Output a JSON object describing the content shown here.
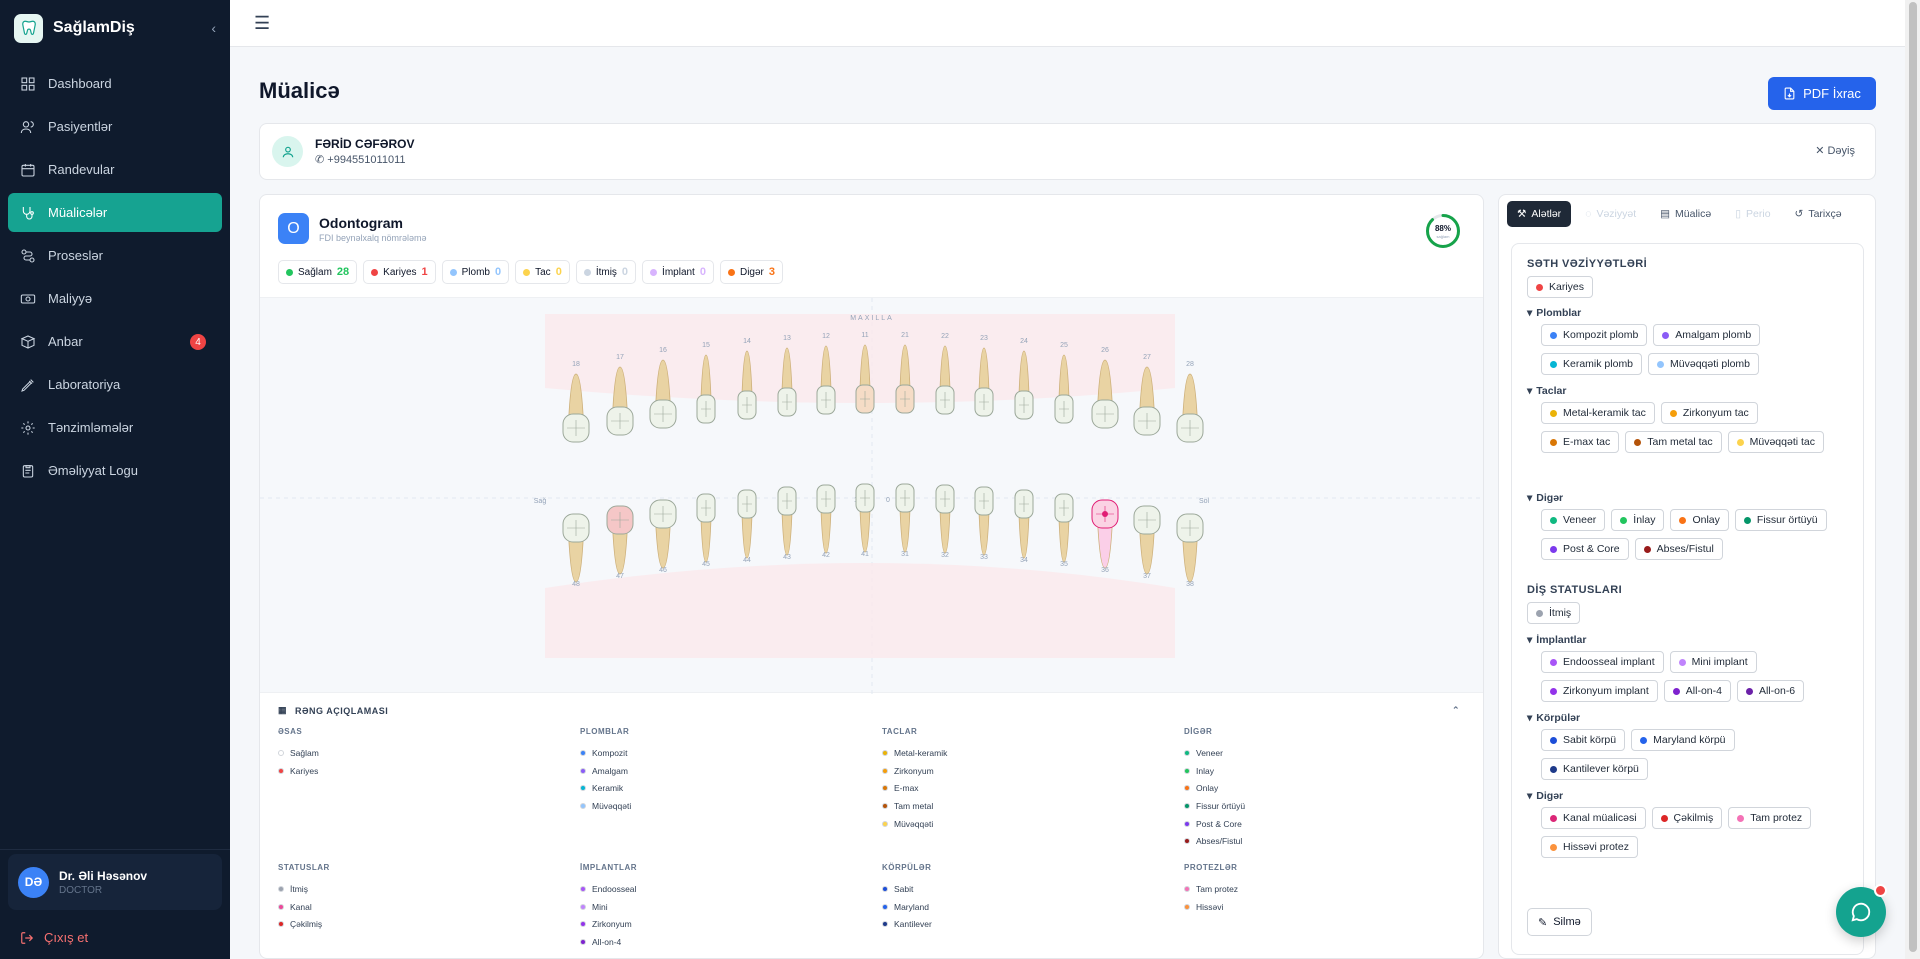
{
  "brand": {
    "name": "SağlamDiş"
  },
  "nav": [
    {
      "label": "Dashboard",
      "icon": "grid-icon",
      "active": false
    },
    {
      "label": "Pasiyentlər",
      "icon": "users-icon",
      "active": false
    },
    {
      "label": "Randevular",
      "icon": "calendar-icon",
      "active": false
    },
    {
      "label": "Müalicələr",
      "icon": "stethoscope-icon",
      "active": true
    },
    {
      "label": "Proseslər",
      "icon": "workflow-icon",
      "active": false
    },
    {
      "label": "Maliyyə",
      "icon": "money-icon",
      "active": false
    },
    {
      "label": "Anbar",
      "icon": "box-icon",
      "active": false,
      "badge": "4"
    },
    {
      "label": "Laboratoriya",
      "icon": "pipette-icon",
      "active": false
    },
    {
      "label": "Tənzimləmələr",
      "icon": "settings-icon",
      "active": false
    },
    {
      "label": "Əməliyyat Logu",
      "icon": "clipboard-icon",
      "active": false
    }
  ],
  "user": {
    "initials": "DƏ",
    "name": "Dr. Əli Həsənov",
    "role": "DOCTOR"
  },
  "logout": "Çıxış et",
  "page": {
    "title": "Müalicə",
    "pdf_button": "PDF İxrac"
  },
  "patient": {
    "name": "FƏRİD CƏFƏROV",
    "phone": "+994551011011",
    "change": "Dəyiş"
  },
  "odontogram": {
    "icon_letter": "O",
    "title": "Odontogram",
    "subtitle": "FDI beynəlxalq nömrələmə",
    "health_percent": "88%",
    "health_label": "sağlam",
    "health_value": 0.88,
    "chips": [
      {
        "label": "Sağlam",
        "count": "28",
        "color": "#22c55e"
      },
      {
        "label": "Kariyes",
        "count": "1",
        "color": "#ef4444"
      },
      {
        "label": "Plomb",
        "count": "0",
        "color": "#93c5fd"
      },
      {
        "label": "Tac",
        "count": "0",
        "color": "#fcd34d"
      },
      {
        "label": "İtmiş",
        "count": "0",
        "color": "#cbd5e1"
      },
      {
        "label": "İmplant",
        "count": "0",
        "color": "#d8b4fe"
      },
      {
        "label": "Digər",
        "count": "3",
        "color": "#f97316"
      }
    ],
    "upper_label": "MAXILLA",
    "side_left": "Sağ",
    "side_right": "Sol",
    "mid_top": "1",
    "mid_right": "0",
    "upper_teeth": [
      "18",
      "17",
      "16",
      "15",
      "14",
      "13",
      "12",
      "11",
      "21",
      "22",
      "23",
      "24",
      "25",
      "26",
      "27",
      "28"
    ],
    "lower_teeth": [
      "48",
      "47",
      "46",
      "45",
      "44",
      "43",
      "42",
      "41",
      "31",
      "32",
      "33",
      "34",
      "35",
      "36",
      "37",
      "38"
    ]
  },
  "legend": {
    "title": "RƏNG AÇIQLAMASI",
    "groups": [
      {
        "title": "ƏSAS",
        "items": [
          {
            "label": "Sağlam",
            "color": "#ffffff"
          },
          {
            "label": "Kariyes",
            "color": "#ef4444"
          }
        ]
      },
      {
        "title": "PLOMBLAR",
        "items": [
          {
            "label": "Kompozit",
            "color": "#3b82f6"
          },
          {
            "label": "Amalgam",
            "color": "#8b5cf6"
          },
          {
            "label": "Keramik",
            "color": "#06b6d4"
          },
          {
            "label": "Müvəqqəti",
            "color": "#93c5fd"
          }
        ]
      },
      {
        "title": "TACLAR",
        "items": [
          {
            "label": "Metal-keramik",
            "color": "#eab308"
          },
          {
            "label": "Zirkonyum",
            "color": "#f59e0b"
          },
          {
            "label": "E-max",
            "color": "#d97706"
          },
          {
            "label": "Tam metal",
            "color": "#b45309"
          },
          {
            "label": "Müvəqqəti",
            "color": "#fcd34d"
          }
        ]
      },
      {
        "title": "DİGƏR",
        "items": [
          {
            "label": "Veneer",
            "color": "#10b981"
          },
          {
            "label": "Inlay",
            "color": "#22c55e"
          },
          {
            "label": "Onlay",
            "color": "#f97316"
          },
          {
            "label": "Fissur örtüyü",
            "color": "#059669"
          },
          {
            "label": "Post & Core",
            "color": "#7c3aed"
          },
          {
            "label": "Abses/Fistul",
            "color": "#991b1b"
          }
        ]
      },
      {
        "title": "STATUSLAR",
        "items": [
          {
            "label": "İtmiş",
            "color": "#9ca3af"
          },
          {
            "label": "Kanal",
            "color": "#ec4899"
          },
          {
            "label": "Çəkilmiş",
            "color": "#dc2626"
          }
        ]
      },
      {
        "title": "İMPLANTLAR",
        "items": [
          {
            "label": "Endoosseal",
            "color": "#a855f7"
          },
          {
            "label": "Mini",
            "color": "#c084fc"
          },
          {
            "label": "Zirkonyum",
            "color": "#9333ea"
          },
          {
            "label": "All-on-4",
            "color": "#7e22ce"
          }
        ]
      },
      {
        "title": "KÖRPÜLƏR",
        "items": [
          {
            "label": "Sabit",
            "color": "#1d4ed8"
          },
          {
            "label": "Maryland",
            "color": "#2563eb"
          },
          {
            "label": "Kantilever",
            "color": "#1e3a8a"
          }
        ]
      },
      {
        "title": "PROTEZLƏR",
        "items": [
          {
            "label": "Tam protez",
            "color": "#f472b6"
          },
          {
            "label": "Hissəvi",
            "color": "#fb923c"
          }
        ]
      }
    ]
  },
  "panel": {
    "tabs": [
      {
        "label": "Alətlər",
        "icon": "wrench-icon",
        "state": "active"
      },
      {
        "label": "Vəziyyət",
        "icon": "status-icon",
        "state": "disabled"
      },
      {
        "label": "Müalicə",
        "icon": "clipboard-icon",
        "state": "normal"
      },
      {
        "label": "Perio",
        "icon": "doc-icon",
        "state": "disabled"
      },
      {
        "label": "Tarixçə",
        "icon": "history-icon",
        "state": "normal"
      }
    ],
    "surface_title": "SƏTH VƏZİYYƏTLƏRİ",
    "caries": {
      "label": "Kariyes",
      "color": "#ef4444"
    },
    "fillings_title": "Plomblar",
    "fillings": [
      {
        "label": "Kompozit plomb",
        "color": "#3b82f6"
      },
      {
        "label": "Amalgam plomb",
        "color": "#8b5cf6"
      },
      {
        "label": "Keramik plomb",
        "color": "#06b6d4"
      },
      {
        "label": "Müvəqqəti plomb",
        "color": "#93c5fd"
      }
    ],
    "crowns_title": "Taclar",
    "crowns": [
      {
        "label": "Metal-keramik tac",
        "color": "#eab308"
      },
      {
        "label": "Zirkonyum tac",
        "color": "#f59e0b"
      },
      {
        "label": "E-max tac",
        "color": "#d97706"
      },
      {
        "label": "Tam metal tac",
        "color": "#b45309"
      },
      {
        "label": "Müvəqqəti tac",
        "color": "#fcd34d"
      }
    ],
    "other_title": "Digər",
    "other": [
      {
        "label": "Veneer",
        "color": "#10b981"
      },
      {
        "label": "İnlay",
        "color": "#22c55e"
      },
      {
        "label": "Onlay",
        "color": "#f97316"
      },
      {
        "label": "Fissur örtüyü",
        "color": "#059669"
      },
      {
        "label": "Post & Core",
        "color": "#7c3aed"
      },
      {
        "label": "Abses/Fistul",
        "color": "#991b1b"
      }
    ],
    "status_title": "DİŞ STATUSLARI",
    "missing": {
      "label": "İtmiş",
      "color": "#9ca3af"
    },
    "implants_title": "İmplantlar",
    "implants": [
      {
        "label": "Endoosseal implant",
        "color": "#a855f7"
      },
      {
        "label": "Mini implant",
        "color": "#c084fc"
      },
      {
        "label": "Zirkonyum implant",
        "color": "#9333ea"
      },
      {
        "label": "All-on-4",
        "color": "#7e22ce"
      },
      {
        "label": "All-on-6",
        "color": "#6b21a8"
      }
    ],
    "bridges_title": "Körpülər",
    "bridges": [
      {
        "label": "Sabit körpü",
        "color": "#1d4ed8"
      },
      {
        "label": "Maryland körpü",
        "color": "#2563eb"
      },
      {
        "label": "Kantilever körpü",
        "color": "#1e3a8a"
      }
    ],
    "other2_title": "Digər",
    "other2": [
      {
        "label": "Kanal müalicəsi",
        "color": "#db2777"
      },
      {
        "label": "Çəkilmiş",
        "color": "#dc2626"
      },
      {
        "label": "Tam protez",
        "color": "#f472b6"
      },
      {
        "label": "Hissəvi protez",
        "color": "#fb923c"
      }
    ],
    "erase": "Silmə"
  }
}
